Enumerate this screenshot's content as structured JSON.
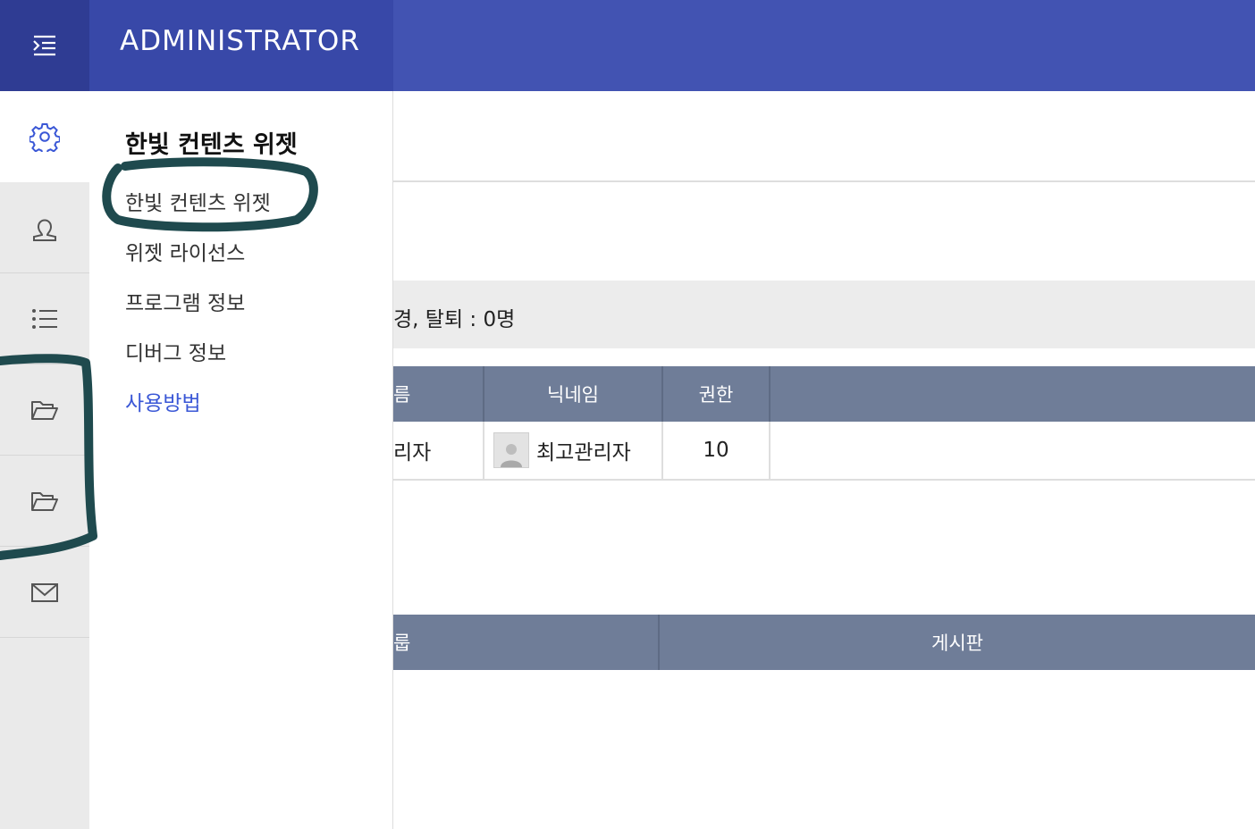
{
  "header": {
    "brand": "ADMINISTRATOR",
    "colors": {
      "bar": "#4253b2",
      "menu_cell": "#2f3c93",
      "brand_cell": "#3848a8"
    }
  },
  "rail": {
    "items": [
      {
        "icon": "gear-icon",
        "active": true
      },
      {
        "icon": "user-icon",
        "active": false
      },
      {
        "icon": "list-icon",
        "active": false
      },
      {
        "icon": "folder-icon",
        "active": false
      },
      {
        "icon": "folder-icon",
        "active": false
      },
      {
        "icon": "mail-icon",
        "active": false
      }
    ]
  },
  "submenu": {
    "title": "한빛 컨텐츠 위젯",
    "items": [
      {
        "label": "한빛 컨텐츠 위젯"
      },
      {
        "label": "위젯 라이선스"
      },
      {
        "label": "프로그램 정보"
      },
      {
        "label": "디버그 정보"
      },
      {
        "label": "사용방법",
        "link": true
      }
    ],
    "link_color": "#3a57d6"
  },
  "main": {
    "stats_text": "경, 탈퇴 : 0명",
    "users_table": {
      "headers": [
        "름",
        "닉네임",
        "권한"
      ],
      "rows": [
        {
          "name": "리자",
          "nickname": "최고관리자",
          "level": "10"
        }
      ]
    },
    "boards_table": {
      "headers": [
        "룹",
        "게시판"
      ]
    },
    "table_header_color": "#6f7d98"
  },
  "annotation_color": "#1f4a4e"
}
